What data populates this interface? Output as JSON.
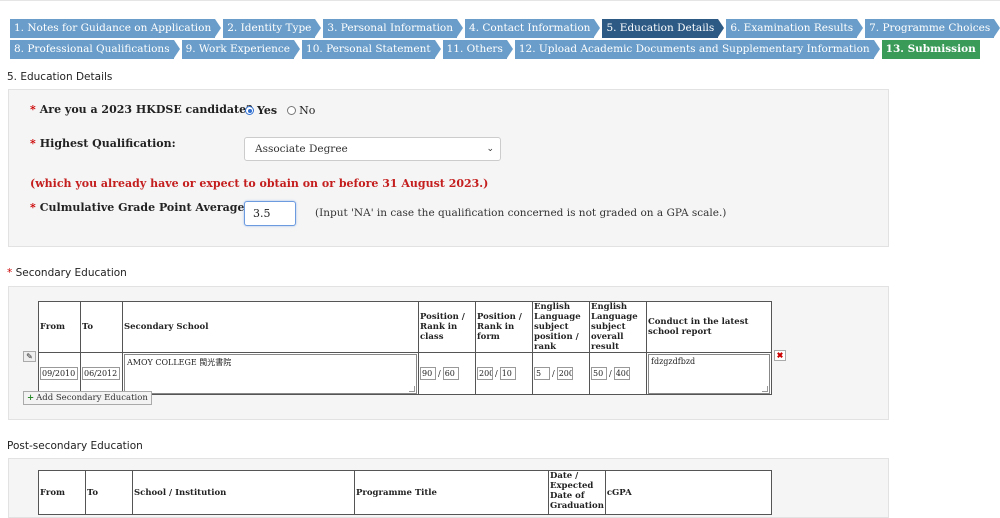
{
  "steps_row1": [
    "1. Notes for Guidance on Application",
    "2. Identity Type",
    "3. Personal Information",
    "4. Contact Information",
    "5. Education Details",
    "6. Examination Results",
    "7. Programme Choices"
  ],
  "steps_row2": [
    "8. Professional Qualifications",
    "9. Work Experience",
    "10. Personal Statement",
    "11. Others",
    "12. Upload Academic Documents and Supplementary Information",
    "13. Submission"
  ],
  "section_title": "5. Education Details",
  "required_mark": "*",
  "q_hkdse": {
    "label": "Are you a 2023 HKDSE candidate?",
    "options": [
      "Yes",
      "No"
    ],
    "selected": "Yes"
  },
  "q_qualification": {
    "label": "Highest Qualification:",
    "value": "Associate Degree"
  },
  "qualification_note": "(which you already have or expect to obtain on or before 31 August 2023.)",
  "q_gpa": {
    "label": "Culmulative Grade Point Average :",
    "value": "3.5",
    "note": "(Input 'NA' in case the qualification concerned is not graded on a GPA scale.)"
  },
  "secondary": {
    "title": "Secondary Education",
    "headers": {
      "from": "From",
      "to": "To",
      "school": "Secondary School",
      "rank_class": "Position / Rank in class",
      "rank_form": "Position / Rank in form",
      "eng_rank": "English Language subject position / rank",
      "eng_result": "English Language subject overall result",
      "conduct": "Conduct in the latest school report"
    },
    "row": {
      "from": "09/2010",
      "to": "06/2012",
      "school": "AMOY COLLEGE 閩光書院",
      "rank_class_a": "90",
      "rank_class_b": "60",
      "rank_form_a": "200",
      "rank_form_b": "10",
      "eng_rank_a": "5",
      "eng_rank_b": "200",
      "eng_result_a": "50",
      "eng_result_b": "400",
      "conduct": "fdzgzdfbzd"
    },
    "add_label": "Add Secondary Education"
  },
  "postsecondary": {
    "title": "Post-secondary Education",
    "headers": {
      "from": "From",
      "to": "To",
      "school": "School / Institution",
      "programme": "Programme Title",
      "date": "Date / Expected Date of Graduation",
      "cgpa": "cGPA"
    }
  },
  "icons": {
    "edit": "pencil-icon",
    "delete": "close-icon",
    "add": "plus-icon",
    "chevron": "chevron-down-icon"
  },
  "colors": {
    "step": "#6a9dc9",
    "step_active": "#2c5a85",
    "step_submit": "#3a9a58",
    "warning": "#c41e1e"
  }
}
